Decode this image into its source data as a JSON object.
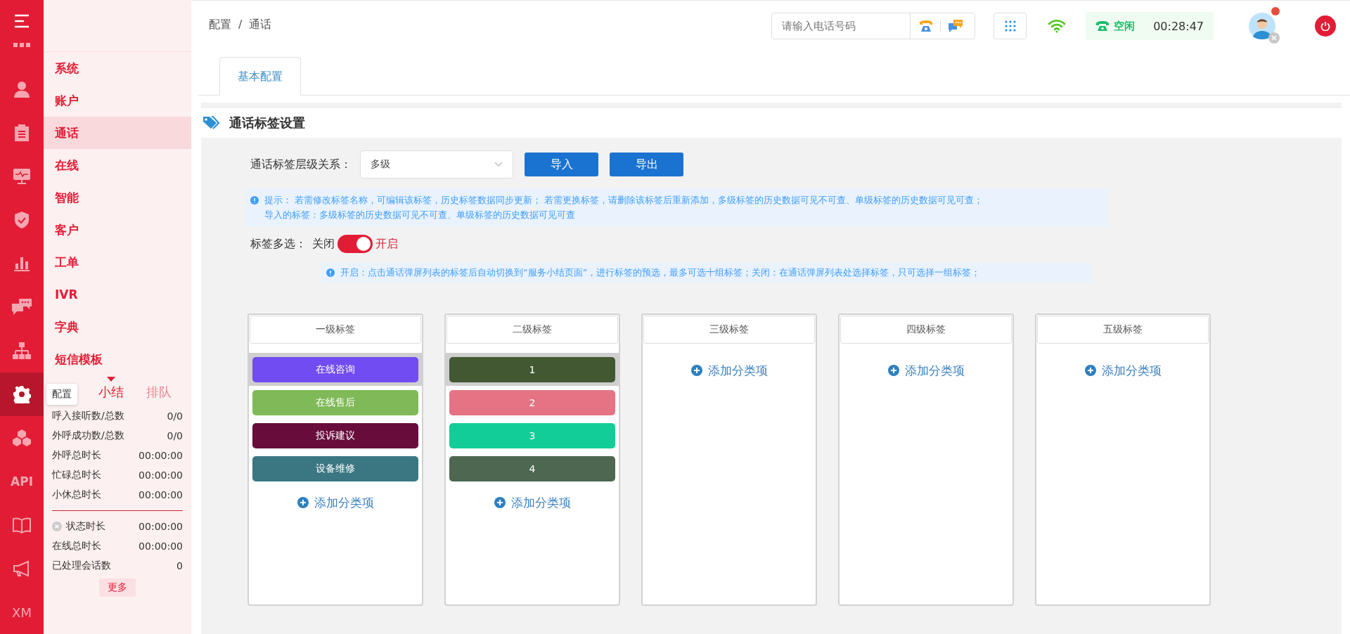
{
  "rail": {
    "items": [
      {
        "kind": "menu",
        "selected": false
      },
      {
        "kind": "grid",
        "selected": false
      },
      {
        "kind": "person",
        "selected": false
      },
      {
        "kind": "clipboard",
        "selected": false
      },
      {
        "kind": "monitor",
        "selected": false
      },
      {
        "kind": "shield",
        "selected": false
      },
      {
        "kind": "chart",
        "selected": false
      },
      {
        "kind": "chat",
        "selected": false
      },
      {
        "kind": "org",
        "selected": false
      },
      {
        "kind": "gear",
        "selected": true
      },
      {
        "kind": "hexagons",
        "selected": false
      },
      {
        "kind": "text",
        "label": "API",
        "selected": false
      },
      {
        "kind": "book",
        "selected": false
      },
      {
        "kind": "megaphone",
        "selected": false
      },
      {
        "kind": "text",
        "label": "XM",
        "selected": false
      }
    ],
    "tooltip": "配置"
  },
  "submenu": {
    "items": [
      {
        "label": "系统",
        "selected": false
      },
      {
        "label": "账户",
        "selected": false
      },
      {
        "label": "通话",
        "selected": true
      },
      {
        "label": "在线",
        "selected": false
      },
      {
        "label": "智能",
        "selected": false
      },
      {
        "label": "客户",
        "selected": false
      },
      {
        "label": "工单",
        "selected": false
      },
      {
        "label": "IVR",
        "selected": false
      },
      {
        "label": "字典",
        "selected": false
      },
      {
        "label": "短信模板",
        "selected": false
      }
    ]
  },
  "stats": {
    "tabs": [
      {
        "label": "小结",
        "selected": true
      },
      {
        "label": "排队",
        "selected": false
      }
    ],
    "rows": [
      {
        "label": "呼入接听数/总数",
        "value": "0/0",
        "divider_before": false,
        "clear_icon": false
      },
      {
        "label": "外呼成功数/总数",
        "value": "0/0",
        "divider_before": false,
        "clear_icon": false
      },
      {
        "label": "外呼总时长",
        "value": "00:00:00",
        "divider_before": false,
        "clear_icon": false
      },
      {
        "label": "忙碌总时长",
        "value": "00:00:00",
        "divider_before": false,
        "clear_icon": false
      },
      {
        "label": "小休总时长",
        "value": "00:00:00",
        "divider_before": false,
        "clear_icon": false
      },
      {
        "label": "状态时长",
        "value": "00:00:00",
        "divider_before": true,
        "clear_icon": true
      },
      {
        "label": "在线总时长",
        "value": "00:00:00",
        "divider_before": false,
        "clear_icon": false
      },
      {
        "label": "已处理会话数",
        "value": "0",
        "divider_before": false,
        "clear_icon": false
      }
    ],
    "more": "更多"
  },
  "header": {
    "breadcrumb": [
      "配置",
      "通话"
    ],
    "separator": "/",
    "phone_placeholder": "请输入电话号码",
    "status": "空闲",
    "timer": "00:28:47",
    "notification": true
  },
  "tabs": [
    {
      "label": "基本配置",
      "selected": true
    }
  ],
  "section": {
    "title": "通话标签设置",
    "level_label": "通话标签层级关系：",
    "level_value": "多级",
    "buttons": [
      "导入",
      "导出"
    ],
    "hint": [
      "提示：  若需修改标签名称，可编辑该标签，历史标签数据同步更新；  若需更换标签，请删除该标签后重新添加，多级标签的历史数据可见不可查、单级标签的历史数据可见可查；",
      "导入的标签：多级标签的历史数据可见不可查、单级标签的历史数据可见可查"
    ],
    "multi": {
      "label": "标签多选：",
      "off_text": "关闭",
      "on_text": "开启",
      "on": true
    },
    "multi_hint": "开启：点击通话弹屏列表的标签后自动切换到“服务小结页面”，进行标签的预选，最多可选十组标签；关闭：在通话弹屏列表处选择标签，只可选择一组标签；",
    "columns": [
      {
        "title": "一级标签",
        "add": "添加分类项",
        "items": [
          {
            "label": "在线咨询",
            "color": "#714cf2",
            "selected": true
          },
          {
            "label": "在线售后",
            "color": "#80ba58",
            "selected": false
          },
          {
            "label": "投诉建议",
            "color": "#680c3c",
            "selected": false
          },
          {
            "label": "设备维修",
            "color": "#3a7782",
            "selected": false
          }
        ]
      },
      {
        "title": "二级标签",
        "add": "添加分类项",
        "items": [
          {
            "label": "1",
            "color": "#425832",
            "selected": true
          },
          {
            "label": "2",
            "color": "#e57384",
            "selected": false
          },
          {
            "label": "3",
            "color": "#12cd98",
            "selected": false
          },
          {
            "label": "4",
            "color": "#4d6751",
            "selected": false
          }
        ]
      },
      {
        "title": "三级标签",
        "add": "添加分类项"
      },
      {
        "title": "四级标签",
        "add": "添加分类项"
      },
      {
        "title": "五级标签",
        "add": "添加分类项"
      }
    ]
  }
}
